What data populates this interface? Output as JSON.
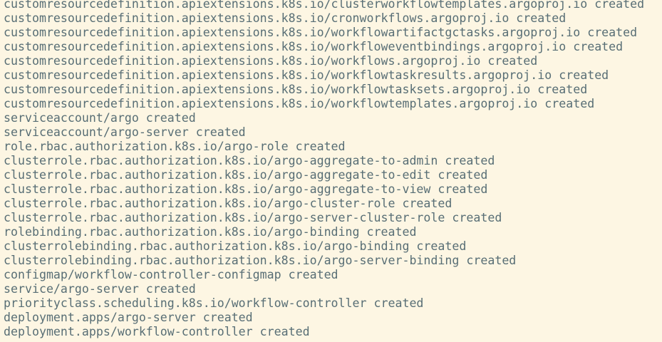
{
  "terminal": {
    "lines": [
      "customresourcedefinition.apiextensions.k8s.io/clusterworkflowtemplates.argoproj.io created",
      "customresourcedefinition.apiextensions.k8s.io/cronworkflows.argoproj.io created",
      "customresourcedefinition.apiextensions.k8s.io/workflowartifactgctasks.argoproj.io created",
      "customresourcedefinition.apiextensions.k8s.io/workfloweventbindings.argoproj.io created",
      "customresourcedefinition.apiextensions.k8s.io/workflows.argoproj.io created",
      "customresourcedefinition.apiextensions.k8s.io/workflowtaskresults.argoproj.io created",
      "customresourcedefinition.apiextensions.k8s.io/workflowtasksets.argoproj.io created",
      "customresourcedefinition.apiextensions.k8s.io/workflowtemplates.argoproj.io created",
      "serviceaccount/argo created",
      "serviceaccount/argo-server created",
      "role.rbac.authorization.k8s.io/argo-role created",
      "clusterrole.rbac.authorization.k8s.io/argo-aggregate-to-admin created",
      "clusterrole.rbac.authorization.k8s.io/argo-aggregate-to-edit created",
      "clusterrole.rbac.authorization.k8s.io/argo-aggregate-to-view created",
      "clusterrole.rbac.authorization.k8s.io/argo-cluster-role created",
      "clusterrole.rbac.authorization.k8s.io/argo-server-cluster-role created",
      "rolebinding.rbac.authorization.k8s.io/argo-binding created",
      "clusterrolebinding.rbac.authorization.k8s.io/argo-binding created",
      "clusterrolebinding.rbac.authorization.k8s.io/argo-server-binding created",
      "configmap/workflow-controller-configmap created",
      "service/argo-server created",
      "priorityclass.scheduling.k8s.io/workflow-controller created",
      "deployment.apps/argo-server created",
      "deployment.apps/workflow-controller created"
    ]
  }
}
